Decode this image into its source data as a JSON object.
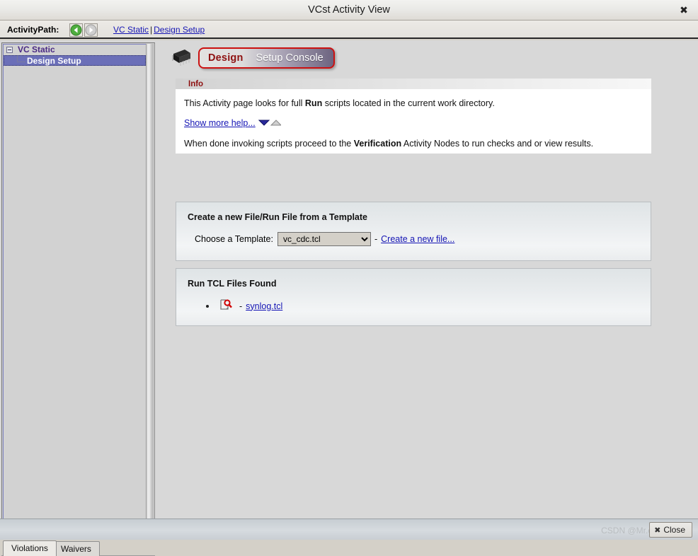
{
  "window": {
    "title": "VCst Activity View",
    "close_glyph": "✖"
  },
  "pathbar": {
    "label": "ActivityPath:",
    "back_icon": "back-arrow-icon",
    "forward_icon": "forward-arrow-icon",
    "crumbs": [
      {
        "label": "VC Static"
      },
      {
        "label": "Design Setup"
      }
    ],
    "separator": "|"
  },
  "tree": {
    "root": {
      "label": "VC Static"
    },
    "child": {
      "label": "Design Setup"
    }
  },
  "bottom_tabs": [
    {
      "label": "Violations",
      "active": true
    },
    {
      "label": "Waivers",
      "active": false
    }
  ],
  "content": {
    "chip_icon": "ic-chip-icon",
    "tab": {
      "primary": "Design",
      "secondary": "Setup Console"
    },
    "info": {
      "header": "Info",
      "line1_pre": "This Activity page looks for full ",
      "line1_bold": "Run",
      "line1_post": " scripts located in the current work directory.",
      "help_link": "Show more help...",
      "expand_icon": "triangle-down-icon",
      "collapse_icon": "triangle-up-icon",
      "line2_pre": "When done invoking scripts proceed to the ",
      "line2_bold": "Verification",
      "line2_post": " Activity Nodes to run checks and or view results."
    },
    "template": {
      "title": "Create a new File/Run File from a Template",
      "choose_label": "Choose a Template:",
      "selected": "vc_cdc.tcl",
      "options": [
        "vc_cdc.tcl"
      ],
      "dash": "-",
      "create_link": "Create a new file..."
    },
    "tclfiles": {
      "title": "Run TCL Files Found",
      "items": [
        {
          "icon": "document-search-icon",
          "dash": "-",
          "label": "synlog.tcl"
        }
      ]
    }
  },
  "statusbar": {
    "close_label": "Close",
    "close_icon_glyph": "✖",
    "watermark": "CSDN @Mr.clean"
  },
  "colors": {
    "link": "#1414b4",
    "accent_red": "#8e1111",
    "tab_border_red": "#cc1111",
    "tree_selection": "#6b6fb8",
    "tree_root_text": "#4a2a84"
  }
}
